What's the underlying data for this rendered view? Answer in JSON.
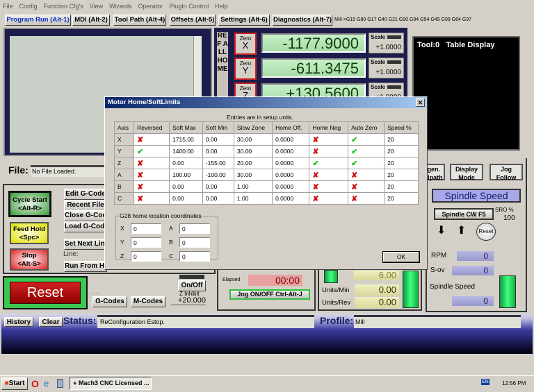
{
  "menu": [
    "File",
    "Config",
    "Function Cfg's",
    "View",
    "Wizards",
    "Operator",
    "PlugIn Control",
    "Help"
  ],
  "tabs": [
    "Program Run (Alt-1)",
    "MDI (Alt-2)",
    "Tool Path (Alt-4)",
    "Offsets (Alt-5)",
    "Settings (Alt-6)",
    "Diagnostics (Alt-7)"
  ],
  "gcode_state": "Mill->G15  G80 G17 G40 G21 G90 G94 G54 G49 G99 G64 G97",
  "dro": {
    "ref_all_home": "REF ALL HOME",
    "zero_label": "Zero",
    "axes": [
      {
        "name": "X",
        "value": "-1177.9000",
        "scale": "+1.0000"
      },
      {
        "name": "Y",
        "value": "-611.3475",
        "scale": "+1.0000"
      },
      {
        "name": "Z",
        "value": "+130.5600",
        "scale": "+1.0000"
      }
    ],
    "scale_label": "Scale"
  },
  "tool_display": {
    "tool": "Tool:0",
    "label": "Table Display"
  },
  "file": {
    "label": "File:",
    "value": "No File Loaded."
  },
  "controls": {
    "cycle_start": "Cycle Start",
    "cycle_start_key": "<Alt-R>",
    "feed_hold": "Feed Hold",
    "feed_hold_key": "<Spc>",
    "stop": "Stop",
    "stop_key": "<Alt-S>",
    "reset": "Reset",
    "edit": "Edit G-Code",
    "recent": "Recent File",
    "close": "Close G-Code",
    "load": "Load G-Code",
    "set_next": "Set Next Line",
    "line": "Line:",
    "run_from": "Run From Here",
    "dots": ".....",
    "gcodes": "G-Codes",
    "mcodes": "M-Codes",
    "onoff": "On/Off",
    "z_inhibit": "Z Inhibit",
    "z_inhibit_value": "+20.000"
  },
  "elapsed": {
    "label": "Elapsed",
    "value": "00:00",
    "jog": "Jog ON/OFF Ctrl-Alt-J"
  },
  "feed": {
    "value": "6.00",
    "units_min_label": "Units/Min",
    "units_min": "0.00",
    "units_rev_label": "Units/Rev",
    "units_rev": "0.00"
  },
  "view_buttons": {
    "regen": "Regen. Toolpath",
    "display": "Display Mode",
    "jog_follow": "Jog Follow"
  },
  "spindle": {
    "title": "Spindle Speed",
    "cw": "Spindle CW F5",
    "sro_label": "SRO %",
    "sro": "100",
    "reset": "Reset",
    "rpm_label": "RPM",
    "rpm": "0",
    "sov_label": "S-ov",
    "sov": "0",
    "speed_label": "Spindle Speed",
    "speed": "0"
  },
  "status": {
    "history": "History",
    "clear": "Clear",
    "label": "Status:",
    "value": "ReConfiguration Estop.",
    "profile_label": "Profile:",
    "profile": "Mill"
  },
  "dialog": {
    "title": "Motor Home/SoftLimits",
    "note": "Entries are in setup units.",
    "columns": [
      "Axis",
      "Reversed",
      "Soft Max",
      "Soft Min",
      "Slow Zone",
      "Home Off.",
      "Home Neg",
      "Auto Zero",
      "Speed %"
    ],
    "rows": [
      [
        "X",
        "no",
        "1715.00",
        "0.00",
        "30.00",
        "0.0000",
        "no",
        "yes",
        "20"
      ],
      [
        "Y",
        "yes",
        "1400.00",
        "0.00",
        "30.00",
        "0.0000",
        "no",
        "yes",
        "20"
      ],
      [
        "Z",
        "no",
        "0.00",
        "-155.00",
        "20.00",
        "0.0000",
        "yes",
        "yes",
        "20"
      ],
      [
        "A",
        "no",
        "100.00",
        "-100.00",
        "30.00",
        "0.0000",
        "no",
        "no",
        "20"
      ],
      [
        "B",
        "no",
        "0.00",
        "0.00",
        "1.00",
        "0.0000",
        "no",
        "no",
        "20"
      ],
      [
        "C",
        "no",
        "0.00",
        "0.00",
        "1.00",
        "0.0000",
        "no",
        "no",
        "20"
      ]
    ],
    "g28_title": "G28 home location coordinates",
    "g28": [
      {
        "axis": "X",
        "value": "0"
      },
      {
        "axis": "Y",
        "value": "0"
      },
      {
        "axis": "Z",
        "value": "0"
      },
      {
        "axis": "A",
        "value": "0"
      },
      {
        "axis": "B",
        "value": "0"
      },
      {
        "axis": "C",
        "value": "0"
      }
    ],
    "ok": "OK"
  },
  "taskbar": {
    "start": "Start",
    "task": "Mach3 CNC  Licensed ...",
    "lang": "EN",
    "time": "12:56 PM"
  },
  "colors": {
    "dro_green": "#a8dca8",
    "navy": "#1c1c4c",
    "title_blue": "#0a246a"
  }
}
